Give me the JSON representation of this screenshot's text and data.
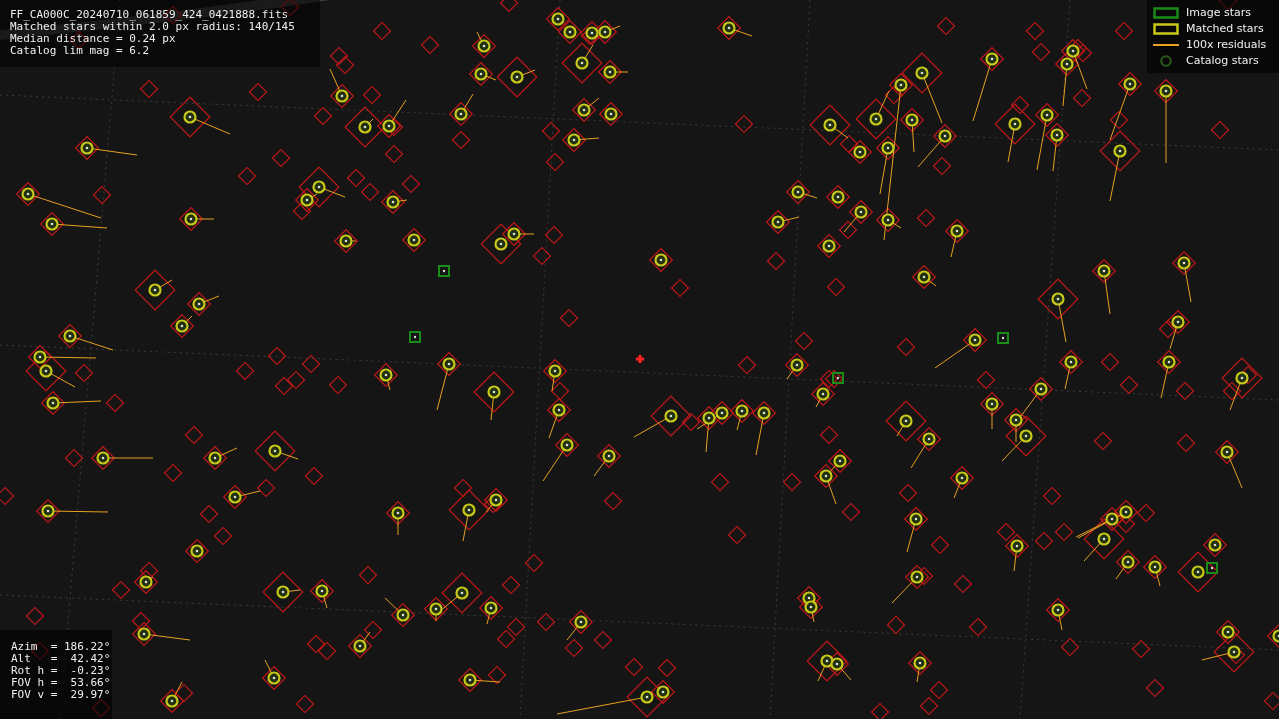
{
  "info_panel": {
    "lines": [
      "FF_CA000C_20240710_061859_424_0421888.fits",
      "Matched stars within 2.0 px radius: 140/145",
      "Median distance = 0.24 px",
      "Catalog lim mag = 6.2"
    ]
  },
  "legend": [
    {
      "kind": "box",
      "label": "Image stars",
      "color": "#1a8c1a"
    },
    {
      "kind": "box",
      "label": "Matched stars",
      "color": "#c8c81a"
    },
    {
      "kind": "line",
      "label": "100x residuals",
      "color": "#e8a020"
    },
    {
      "kind": "ring",
      "label": "Catalog stars",
      "color": "#2a5a1a"
    }
  ],
  "pointing_panel": {
    "lines": [
      "Azim  = 186.22°",
      "Alt   =  42.42°",
      "Rot h =  -0.23°",
      "FOV h =  53.66°",
      "FOV v =  29.97°"
    ]
  }
}
